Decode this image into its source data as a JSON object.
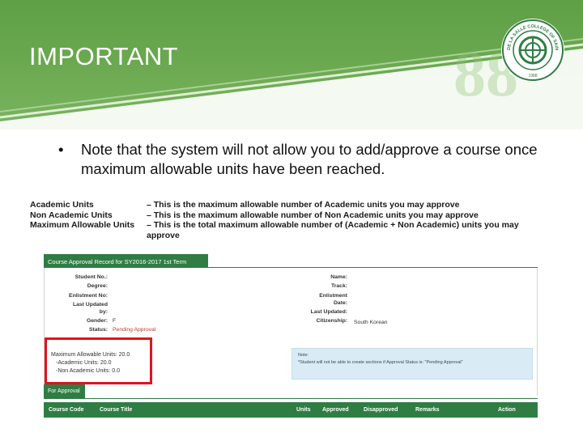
{
  "slide": {
    "title": "IMPORTANT",
    "bullet_symbol": "•",
    "bullet_text": "Note that the system will not allow you to add/approve a course once maximum allowable units have been reached."
  },
  "seal": {
    "arc_text": "DE LA SALLE COLLEGE OF SAINT BENILDE",
    "year": "1988"
  },
  "definitions": [
    {
      "term": "Academic Units",
      "desc": "– This is the maximum allowable number of Academic units you may approve"
    },
    {
      "term": "Non Academic Units",
      "desc": "– This is the maximum allowable number of Non Academic units you may approve"
    },
    {
      "term": "Maximum Allowable Units",
      "desc": "– This is the total maximum allowable number of (Academic + Non Academic) units you may approve"
    }
  ],
  "screenshot": {
    "header": "Course Approval Record for SY2016-2017 1st Term",
    "left_fields": [
      {
        "label": "Student No.:",
        "value": ""
      },
      {
        "label": "Degree:",
        "value": ""
      },
      {
        "label": "Enlistment No:",
        "value": ""
      },
      {
        "label": "Last Updated",
        "value": ""
      },
      {
        "label": "by:",
        "value": ""
      },
      {
        "label": "Gender:",
        "value": "F"
      },
      {
        "label": "Status:",
        "value": "Pending Approval"
      }
    ],
    "right_fields": [
      {
        "label": "Name:",
        "value": ""
      },
      {
        "label": "Track:",
        "value": ""
      },
      {
        "label": "Enlistment",
        "value": ""
      },
      {
        "label": "Date:",
        "value": ""
      },
      {
        "label": "Last Updated:",
        "value": ""
      },
      {
        "label": "Citizenship:",
        "value": "South Korean"
      }
    ],
    "units": {
      "max": "Maximum Allowable Units: 20.0",
      "academic": "-Academic Units: 20.0",
      "non_academic": "-Non Academic Units: 0.0"
    },
    "note": {
      "title": "Note:",
      "text": "*Student will not be able to create sections if Approval Status is: \"Pending Approval\""
    },
    "tab_label": "For Approval",
    "columns": [
      "Course Code",
      "Course Title",
      "Units",
      "Approved",
      "Disapproved",
      "Remarks",
      "Action"
    ]
  },
  "colors": {
    "banner_green": "#6aa84f",
    "table_green": "#2f7d43",
    "highlight_red": "#e3121b",
    "note_blue": "#d9ecf6"
  }
}
